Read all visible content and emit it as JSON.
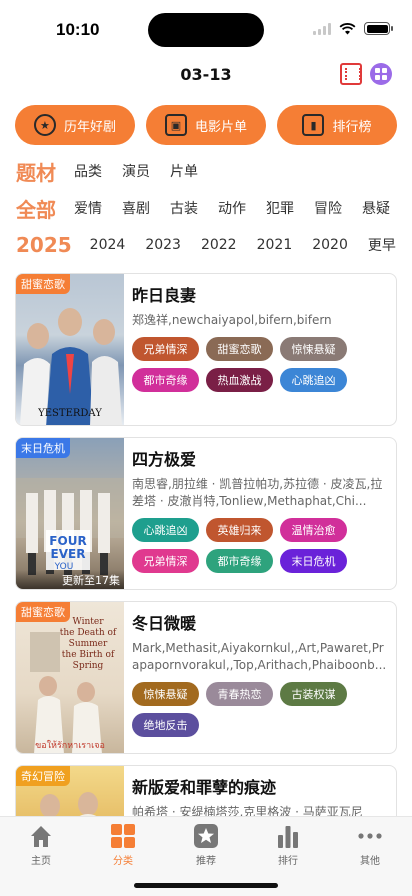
{
  "status": {
    "time": "10:10"
  },
  "header": {
    "title": "03-13",
    "film_icon": "film-icon",
    "menu_icon": "apps-icon"
  },
  "quick": [
    {
      "label": "历年好剧",
      "icon": "medal-icon"
    },
    {
      "label": "电影片单",
      "icon": "film-icon"
    },
    {
      "label": "排行榜",
      "icon": "bar-chart-icon"
    }
  ],
  "filters": {
    "category": {
      "head": "题材",
      "options": [
        "品类",
        "演员",
        "片单"
      ]
    },
    "genre": {
      "head": "全部",
      "options": [
        "爱情",
        "喜剧",
        "古装",
        "动作",
        "犯罪",
        "冒险",
        "悬疑"
      ]
    },
    "year": {
      "head": "2025",
      "options": [
        "2024",
        "2023",
        "2022",
        "2021",
        "2020",
        "更早"
      ]
    }
  },
  "cards": [
    {
      "title": "昨日良妻",
      "cast": "郑逸祥,newchaiyapol,bifern,bifern",
      "badge": "甜蜜恋歌",
      "badge_color": "#f57e35",
      "poster_text": "YESTERDAY",
      "update": "",
      "tags": [
        {
          "label": "兄弟情深",
          "color": "#c0562f"
        },
        {
          "label": "甜蜜恋歌",
          "color": "#8a6a55"
        },
        {
          "label": "惊悚悬疑",
          "color": "#8a7a75"
        },
        {
          "label": "都市奇缘",
          "color": "#d12f9a"
        },
        {
          "label": "热血激战",
          "color": "#7a1f46"
        },
        {
          "label": "心跳追凶",
          "color": "#3c86d6"
        }
      ]
    },
    {
      "title": "四方极爱",
      "cast": "南思睿,朋拉维 · 凯普拉帕功,苏拉德 · 皮凌瓦,拉差塔 · 皮澈肖特,Tonliew,Methaphat,Chi...",
      "badge": "末日危机",
      "badge_color": "#3b78e7",
      "poster_text": "FOUR EVER YOU",
      "update": "更新至17集",
      "tags": [
        {
          "label": "心跳追凶",
          "color": "#1e9f8e"
        },
        {
          "label": "英雄归来",
          "color": "#c0562f"
        },
        {
          "label": "温情治愈",
          "color": "#d12f9a"
        },
        {
          "label": "兄弟情深",
          "color": "#e0398f"
        },
        {
          "label": "都市奇缘",
          "color": "#2ea37d"
        },
        {
          "label": "末日危机",
          "color": "#6a22d9"
        }
      ]
    },
    {
      "title": "冬日微暖",
      "cast": "Mark,Methasit,Aiyakornkul,,Art,Pawaret,Prapapornvorakul,,Top,Arithach,Phaiboonb...",
      "badge": "甜蜜恋歌",
      "badge_color": "#f57e35",
      "poster_text": "Winter the Death of Summer the Birth of Spring",
      "update": "",
      "tags": [
        {
          "label": "惊悚悬疑",
          "color": "#a26a1f"
        },
        {
          "label": "青春热恋",
          "color": "#9a8a9a"
        },
        {
          "label": "古装权谋",
          "color": "#5d7a44"
        },
        {
          "label": "绝地反击",
          "color": "#5c4f9e"
        }
      ]
    },
    {
      "title": "新版爱和罪孽的痕迹",
      "cast": "帕希塔 · 安缇楠塔莎,克里格波 · 马萨亚瓦尼",
      "badge": "奇幻冒险",
      "badge_color": "#f0a020",
      "poster_text": "",
      "update": "",
      "tags": []
    }
  ],
  "tabbar": [
    {
      "label": "主页",
      "icon": "home-icon"
    },
    {
      "label": "分类",
      "icon": "category-icon"
    },
    {
      "label": "推荐",
      "icon": "star-icon"
    },
    {
      "label": "排行",
      "icon": "bar-chart-icon"
    },
    {
      "label": "其他",
      "icon": "more-icon"
    }
  ]
}
